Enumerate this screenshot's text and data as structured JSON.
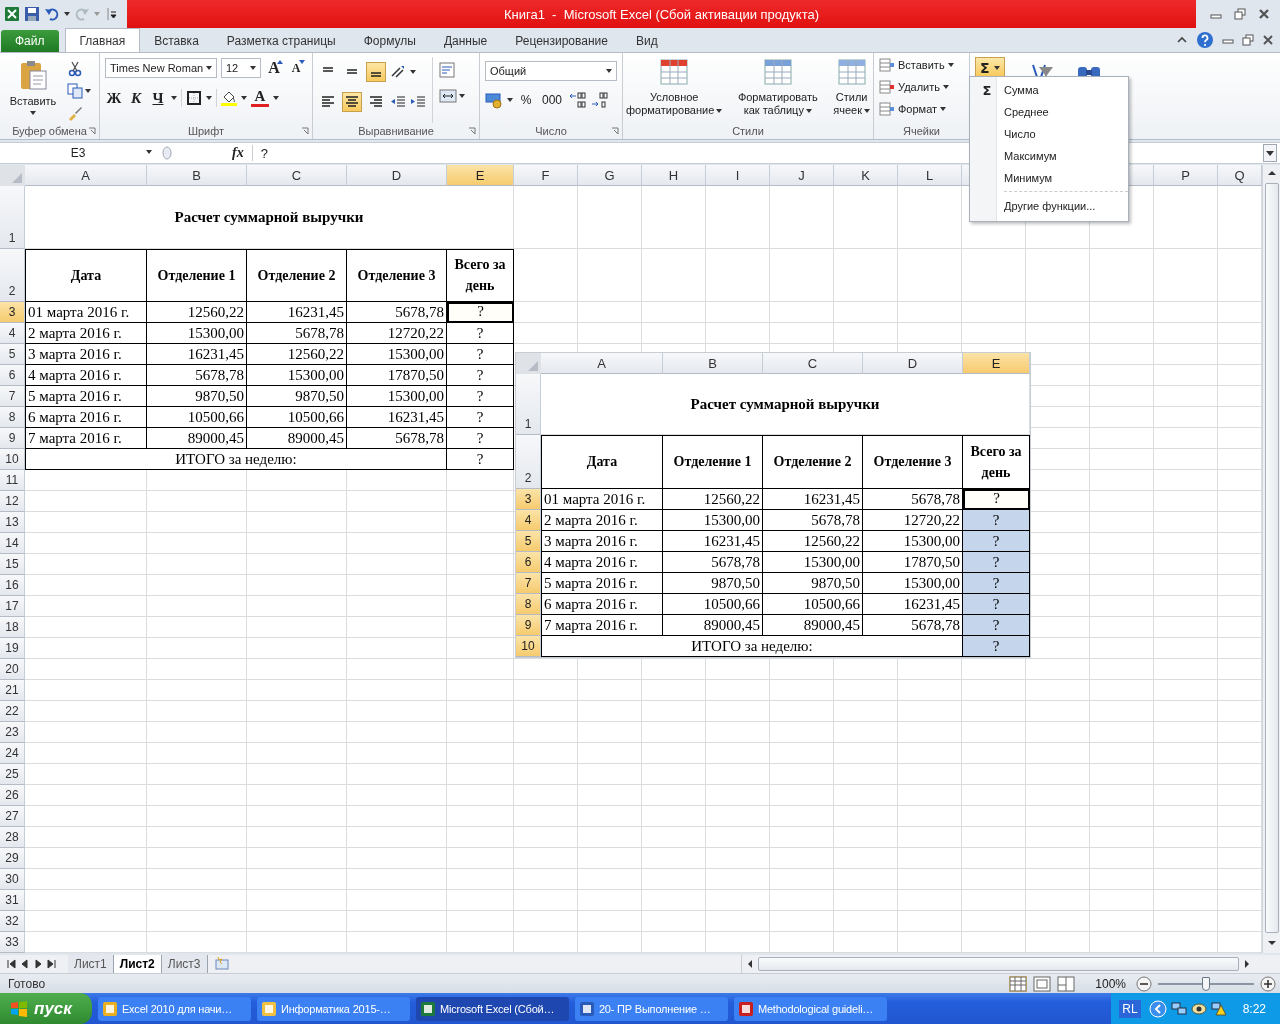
{
  "title_bar": {
    "title": "Книга1  -  Microsoft Excel (Сбой активации продукта)"
  },
  "ribbon_tabs": [
    {
      "label": "Файл",
      "kind": "file",
      "selected": false
    },
    {
      "label": "Главная",
      "kind": "tab",
      "selected": true
    },
    {
      "label": "Вставка",
      "kind": "tab",
      "selected": false
    },
    {
      "label": "Разметка страницы",
      "kind": "tab",
      "selected": false
    },
    {
      "label": "Формулы",
      "kind": "tab",
      "selected": false
    },
    {
      "label": "Данные",
      "kind": "tab",
      "selected": false
    },
    {
      "label": "Рецензирование",
      "kind": "tab",
      "selected": false
    },
    {
      "label": "Вид",
      "kind": "tab",
      "selected": false
    }
  ],
  "clipboard": {
    "paste": "Вставить",
    "label": "Буфер обмена"
  },
  "font": {
    "name": "Times New Roman",
    "size": "12",
    "grow": "A",
    "shrink": "A",
    "bold": "Ж",
    "italic": "К",
    "underline": "Ч",
    "color_letter": "A",
    "label": "Шрифт"
  },
  "alignment": {
    "vertical": [
      {
        "kind": "top",
        "selected": false
      },
      {
        "kind": "middle",
        "selected": false
      },
      {
        "kind": "bottom",
        "selected": true
      }
    ],
    "horizontal": [
      {
        "kind": "left",
        "selected": false
      },
      {
        "kind": "center",
        "selected": true
      },
      {
        "kind": "right",
        "selected": false
      }
    ],
    "label": "Выравнивание"
  },
  "number": {
    "format": "Общий",
    "percent": "%",
    "thousands": "000",
    "label": "Число"
  },
  "styles": {
    "buttons": [
      {
        "lines": [
          "Условное",
          "форматирование"
        ],
        "kind": "conditional"
      },
      {
        "lines": [
          "Форматировать",
          "как таблицу"
        ],
        "kind": "table"
      },
      {
        "lines": [
          "Стили",
          "ячеек"
        ],
        "kind": "cell"
      }
    ],
    "label": "Стили"
  },
  "cells": {
    "buttons": [
      {
        "label": "Вставить",
        "kind": "insert"
      },
      {
        "label": "Удалить",
        "kind": "delete"
      },
      {
        "label": "Формат",
        "kind": "format"
      }
    ],
    "label": "Ячейки"
  },
  "autosum": {
    "glyph": "Σ",
    "open": true
  },
  "autosum_menu": {
    "items": [
      {
        "label": "Сумма",
        "kind": "sum",
        "glyph": "Σ"
      },
      {
        "label": "Среднее",
        "kind": "plain"
      },
      {
        "label": "Число",
        "kind": "plain"
      },
      {
        "label": "Максимум",
        "kind": "plain"
      },
      {
        "label": "Минимум",
        "kind": "plain"
      },
      {
        "label": "Другие функции...",
        "kind": "more"
      }
    ]
  },
  "formula_bar": {
    "name_box": "E3",
    "fx": "fx",
    "formula": "?"
  },
  "sheet": {
    "columns": [
      {
        "label": "A",
        "selected": false
      },
      {
        "label": "B",
        "selected": false
      },
      {
        "label": "C",
        "selected": false
      },
      {
        "label": "D",
        "selected": false
      },
      {
        "label": "E",
        "selected": true
      },
      {
        "label": "F",
        "selected": false
      },
      {
        "label": "G",
        "selected": false
      },
      {
        "label": "H",
        "selected": false
      },
      {
        "label": "I",
        "selected": false
      },
      {
        "label": "J",
        "selected": false
      },
      {
        "label": "K",
        "selected": false
      },
      {
        "label": "L",
        "selected": false
      },
      {
        "label": "P",
        "selected": false
      },
      {
        "label": "Q",
        "selected": false
      }
    ],
    "rows": [
      {
        "label": "1",
        "selected": false
      },
      {
        "label": "2",
        "selected": false
      },
      {
        "label": "3",
        "selected": true
      },
      {
        "label": "4",
        "selected": false
      },
      {
        "label": "5",
        "selected": false
      },
      {
        "label": "6",
        "selected": false
      },
      {
        "label": "7",
        "selected": false
      },
      {
        "label": "8",
        "selected": false
      },
      {
        "label": "9",
        "selected": false
      },
      {
        "label": "10",
        "selected": false
      },
      {
        "label": "11",
        "selected": false
      },
      {
        "label": "12",
        "selected": false
      },
      {
        "label": "13",
        "selected": false
      },
      {
        "label": "14",
        "selected": false
      },
      {
        "label": "15",
        "selected": false
      },
      {
        "label": "16",
        "selected": false
      },
      {
        "label": "17",
        "selected": false
      },
      {
        "label": "18",
        "selected": false
      },
      {
        "label": "19",
        "selected": false
      },
      {
        "label": "20",
        "selected": false
      },
      {
        "label": "21",
        "selected": false
      },
      {
        "label": "22",
        "selected": false
      },
      {
        "label": "23",
        "selected": false
      },
      {
        "label": "24",
        "selected": false
      },
      {
        "label": "25",
        "selected": false
      },
      {
        "label": "26",
        "selected": false
      },
      {
        "label": "27",
        "selected": false
      },
      {
        "label": "28",
        "selected": false
      },
      {
        "label": "29",
        "selected": false
      },
      {
        "label": "30",
        "selected": false
      },
      {
        "label": "31",
        "selected": false
      },
      {
        "label": "32",
        "selected": false
      },
      {
        "label": "33",
        "selected": false
      }
    ],
    "title": "Расчет суммарной выручки",
    "headers": [
      "Дата",
      "Отделение 1",
      "Отделение 2",
      "Отделение 3",
      "Всего за день"
    ],
    "data": [
      {
        "date": "01 марта 2016 г.",
        "values": [
          "12560,22",
          "16231,45",
          "5678,78"
        ],
        "total": "?",
        "total_selected": true,
        "total_active": true
      },
      {
        "date": "2 марта 2016 г.",
        "values": [
          "15300,00",
          "5678,78",
          "12720,22"
        ],
        "total": "?",
        "total_selected": false,
        "total_active": false
      },
      {
        "date": "3 марта 2016 г.",
        "values": [
          "16231,45",
          "12560,22",
          "15300,00"
        ],
        "total": "?",
        "total_selected": false,
        "total_active": false
      },
      {
        "date": "4 марта 2016 г.",
        "values": [
          "5678,78",
          "15300,00",
          "17870,50"
        ],
        "total": "?",
        "total_selected": false,
        "total_active": false
      },
      {
        "date": "5 марта 2016 г.",
        "values": [
          "9870,50",
          "9870,50",
          "15300,00"
        ],
        "total": "?",
        "total_selected": false,
        "total_active": false
      },
      {
        "date": "6 марта 2016 г.",
        "values": [
          "10500,66",
          "10500,66",
          "16231,45"
        ],
        "total": "?",
        "total_selected": false,
        "total_active": false
      },
      {
        "date": "7 марта 2016 г.",
        "values": [
          "89000,45",
          "89000,45",
          "5678,78"
        ],
        "total": "?",
        "total_selected": false,
        "total_active": false
      }
    ],
    "footer": {
      "label": "ИТОГО за неделю:",
      "value": "?",
      "selected": false,
      "active": false
    }
  },
  "picture": {
    "columns": [
      {
        "label": "A",
        "selected": false
      },
      {
        "label": "B",
        "selected": false
      },
      {
        "label": "C",
        "selected": false
      },
      {
        "label": "D",
        "selected": false
      },
      {
        "label": "E",
        "selected": true
      }
    ],
    "rows": [
      {
        "label": "1",
        "selected": false
      },
      {
        "label": "2",
        "selected": false
      },
      {
        "label": "3",
        "selected": true
      },
      {
        "label": "4",
        "selected": true
      },
      {
        "label": "5",
        "selected": true
      },
      {
        "label": "6",
        "selected": true
      },
      {
        "label": "7",
        "selected": true
      },
      {
        "label": "8",
        "selected": true
      },
      {
        "label": "9",
        "selected": true
      },
      {
        "label": "10",
        "selected": true
      }
    ],
    "title": "Расчет суммарной выручки",
    "headers": [
      "Дата",
      "Отделение 1",
      "Отделение 2",
      "Отделение 3",
      "Всего за день"
    ],
    "data": [
      {
        "date": "01 марта 2016 г.",
        "values": [
          "12560,22",
          "16231,45",
          "5678,78"
        ],
        "total": "?",
        "total_selected": true,
        "total_active": true
      },
      {
        "date": "2 марта 2016 г.",
        "values": [
          "15300,00",
          "5678,78",
          "12720,22"
        ],
        "total": "?",
        "total_selected": true,
        "total_active": false
      },
      {
        "date": "3 марта 2016 г.",
        "values": [
          "16231,45",
          "12560,22",
          "15300,00"
        ],
        "total": "?",
        "total_selected": true,
        "total_active": false
      },
      {
        "date": "4 марта 2016 г.",
        "values": [
          "5678,78",
          "15300,00",
          "17870,50"
        ],
        "total": "?",
        "total_selected": true,
        "total_active": false
      },
      {
        "date": "5 марта 2016 г.",
        "values": [
          "9870,50",
          "9870,50",
          "15300,00"
        ],
        "total": "?",
        "total_selected": true,
        "total_active": false
      },
      {
        "date": "6 марта 2016 г.",
        "values": [
          "10500,66",
          "10500,66",
          "16231,45"
        ],
        "total": "?",
        "total_selected": true,
        "total_active": false
      },
      {
        "date": "7 марта 2016 г.",
        "values": [
          "89000,45",
          "89000,45",
          "5678,78"
        ],
        "total": "?",
        "total_selected": true,
        "total_active": false
      }
    ],
    "footer": {
      "label": "ИТОГО за неделю:",
      "value": "?",
      "selected": true,
      "active": false
    }
  },
  "sheet_tabs": [
    {
      "label": "Лист1",
      "selected": false
    },
    {
      "label": "Лист2",
      "selected": true
    },
    {
      "label": "Лист3",
      "selected": false
    }
  ],
  "status_bar": {
    "status": "Готово",
    "zoom": "100%",
    "level": 0.5
  },
  "taskbar": {
    "start": "пуск",
    "items": [
      {
        "label": "Excel 2010 для начи…",
        "kind": "browser",
        "selected": false
      },
      {
        "label": "Информатика 2015-…",
        "kind": "folder",
        "selected": false
      },
      {
        "label": "Microsoft Excel (Сбой…",
        "kind": "excel",
        "selected": true
      },
      {
        "label": "20- ПР Выполнение …",
        "kind": "word",
        "selected": false
      },
      {
        "label": "Methodological guideli…",
        "kind": "pdf",
        "selected": false
      }
    ],
    "language": "RL",
    "clock": "8:22"
  }
}
